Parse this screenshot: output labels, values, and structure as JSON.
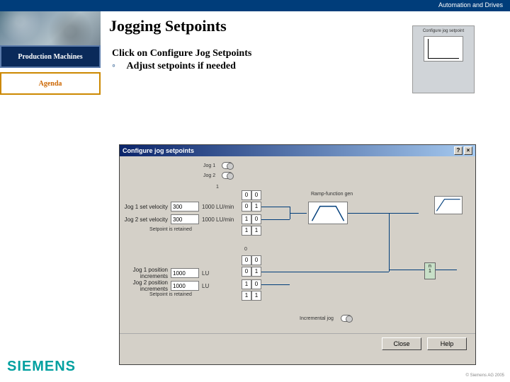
{
  "topbar": {
    "text": "Automation and Drives"
  },
  "header": {
    "title": "Jogging Setpoints"
  },
  "sidebar": {
    "item1": "Production Machines",
    "item2": "Agenda"
  },
  "content": {
    "line1_pre": "Click on  ",
    "line1_link": "Configure Jog Setpoints",
    "bullet1": "Adjust setpoints if needed"
  },
  "thumb": {
    "title": "Configure jog setpoint"
  },
  "dialog": {
    "title": "Configure jog setpoints",
    "help_btn": "?",
    "close_x": "×",
    "jog1_label": "Jog 1",
    "jog2_label": "Jog 2",
    "fields": {
      "jog1_vel": {
        "label": "Jog 1 set velocity",
        "value": "300",
        "unit": "1000 LU/min"
      },
      "jog2_vel": {
        "label": "Jog 2 set velocity",
        "value": "300",
        "unit": "1000 LU/min"
      },
      "retained1": "Setpoint is retained",
      "jog1_pos": {
        "label": "Jog 1 position increments",
        "value": "1000",
        "unit": "LU"
      },
      "jog2_pos": {
        "label": "Jog 2 position increments",
        "value": "1000",
        "unit": "LU"
      },
      "retained2": "Setpoint is retained",
      "ramp_label": "Ramp-function gen",
      "incr_label": "Incremental jog"
    },
    "grid1": {
      "r0c0": "0",
      "r0c1": "0",
      "r1c0": "0",
      "r1c1": "1",
      "r2c0": "1",
      "r2c1": "0",
      "r3c0": "1",
      "r3c1": "1"
    },
    "grid2": {
      "hdr": "0",
      "r0c0": "0",
      "r0c1": "0",
      "r1c0": "0",
      "r1c1": "1",
      "r2c0": "1",
      "r2c1": "0",
      "r3c0": "1",
      "r3c1": "1"
    },
    "out": {
      "top": "n",
      "bot": "1"
    },
    "buttons": {
      "close": "Close",
      "help": "Help"
    }
  },
  "brand": "SIEMENS",
  "footer_right": "© Siemens AG 2005"
}
